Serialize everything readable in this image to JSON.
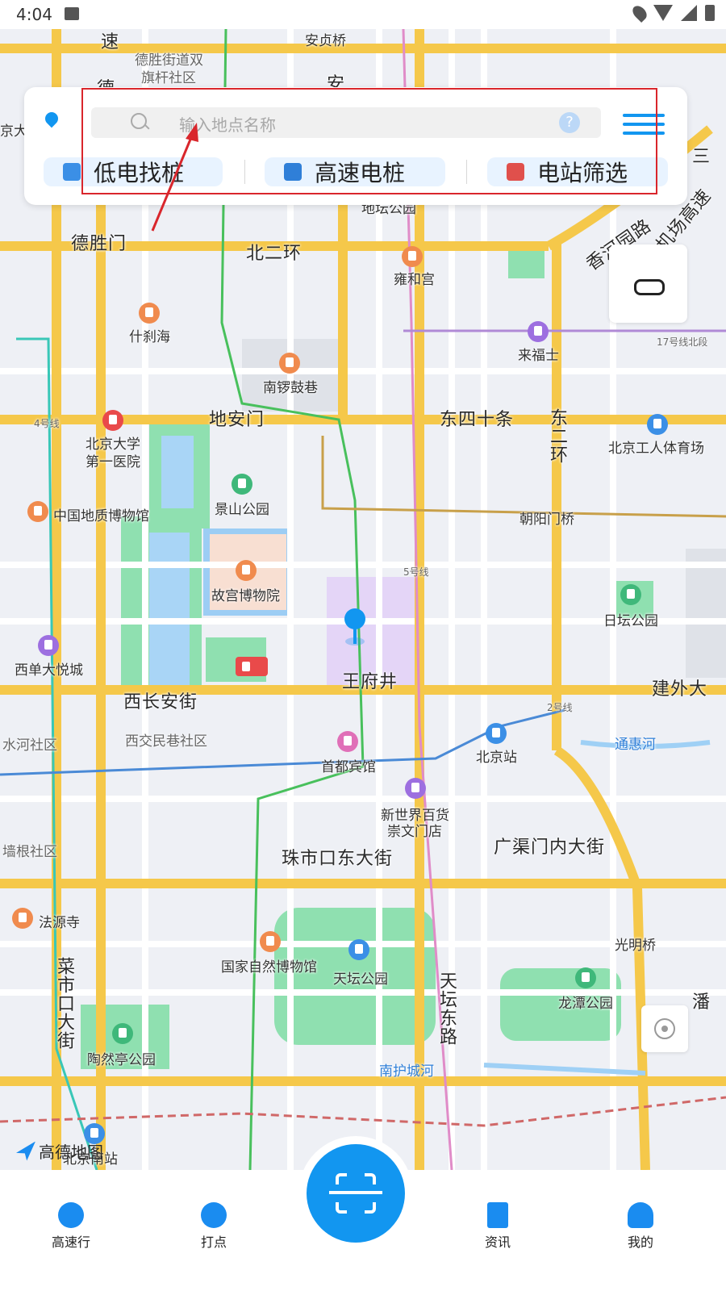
{
  "status_bar": {
    "time": "4:04"
  },
  "search": {
    "placeholder": "输入地点名称",
    "help": "?"
  },
  "quick_filters": [
    {
      "label": "低电找桩",
      "icon": "battery-charge-icon"
    },
    {
      "label": "高速电桩",
      "icon": "highway-icon"
    },
    {
      "label": "电站筛选",
      "icon": "filter-icon"
    }
  ],
  "map": {
    "provider": "高德地图",
    "labels": {
      "anzhen": "安贞桥",
      "deshengjie": "德胜街道双",
      "qigan": "旗杆社区",
      "deshengmen": "德胜门",
      "beierhuan": "北二环",
      "yonghegong": "雍和宫",
      "ditan": "地坛公园",
      "shichahai": "什刹海",
      "laifushi": "来福士",
      "nanluogu": "南锣鼓巷",
      "line17": "17号线北段",
      "dianmen": "地安门",
      "dongsi": "东四十条",
      "dongerhuan": "东二环",
      "bjdx1": "北京大学",
      "bjdx2": "第一医院",
      "gongti": "北京工人体育场",
      "line4": "4号线",
      "dizhi": "中国地质博物馆",
      "jingshan": "景山公园",
      "chaoyangmen": "朝阳门桥",
      "line5": "5号线",
      "gugong": "故宫博物院",
      "ritan": "日坛公园",
      "xidan": "西单大悦城",
      "wangfujing": "王府井",
      "xichangan": "西长安街",
      "jianwai": "建外大",
      "line2": "2号线",
      "xijiao": "西交民巷社区",
      "shuihe": "水河社区",
      "tonghui": "通惠河",
      "shoudu": "首都宾馆",
      "bjz": "北京站",
      "xinshijie1": "新世界百货",
      "xinshijie2": "崇文门店",
      "qianggen": "墙根社区",
      "zhushikou": "珠市口东大街",
      "guangqu": "广渠门内大街",
      "fayuan": "法源寺",
      "guangming": "光明桥",
      "ziran": "国家自然博物馆",
      "tiantan": "天坛公园",
      "caishi": "菜市口大街",
      "tiantandong": "天坛东路",
      "longtan": "龙潭公园",
      "taoranting": "陶然亭公园",
      "nanhu": "南护城河",
      "pan": "潘",
      "jiangtai": "香河园路",
      "jichang": "机场高速",
      "bjnz": "北京南站",
      "anding": "安",
      "su": "速",
      "de": "德",
      "daxue": "京大学",
      "san": "三"
    }
  },
  "bottom_nav": {
    "items": [
      {
        "label": "高速行",
        "icon": "speedometer-icon"
      },
      {
        "label": "打点",
        "icon": "lightning-icon"
      },
      {
        "label": "资讯",
        "icon": "document-icon"
      },
      {
        "label": "我的",
        "icon": "user-icon"
      }
    ],
    "scan": "scan-icon"
  },
  "colors": {
    "accent": "#1296f0",
    "annotation": "#d9262c"
  }
}
